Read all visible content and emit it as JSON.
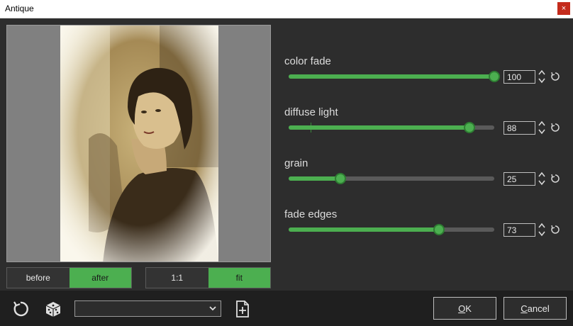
{
  "window": {
    "title": "Antique",
    "close_glyph": "×"
  },
  "view_toggle": {
    "before": "before",
    "after": "after",
    "active": "after"
  },
  "zoom_toggle": {
    "one_to_one": "1:1",
    "fit": "fit",
    "active": "fit"
  },
  "sliders": [
    {
      "label": "color fade",
      "value": "100",
      "fraction": 1.0
    },
    {
      "label": "diffuse light",
      "value": "88",
      "fraction": 0.88
    },
    {
      "label": "grain",
      "value": "25",
      "fraction": 0.25
    },
    {
      "label": "fade edges",
      "value": "73",
      "fraction": 0.73
    }
  ],
  "footer": {
    "preset_value": "",
    "ok_prefix": "O",
    "ok_rest": "K",
    "cancel_prefix": "C",
    "cancel_rest": "ancel"
  },
  "colors": {
    "accent": "#4caf50",
    "background": "#2d2d2d",
    "footer": "#1f1f1f"
  },
  "icons": [
    "close-icon",
    "reset-icon",
    "dice-icon",
    "chevron-down-icon",
    "add-file-icon",
    "spin-arrows-icon"
  ]
}
